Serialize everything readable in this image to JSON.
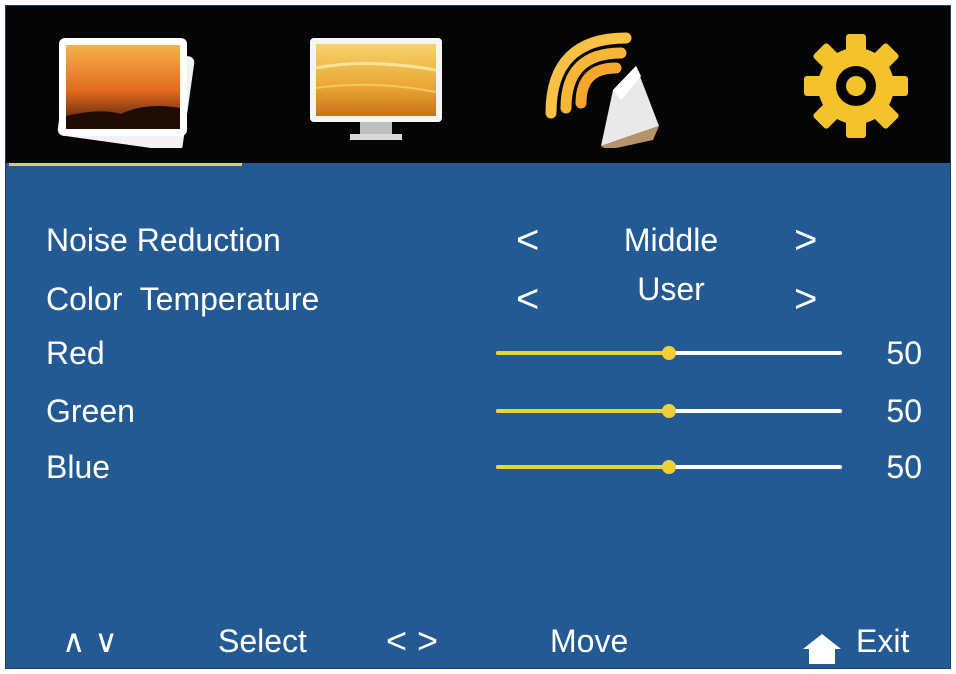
{
  "tabs": [
    {
      "name": "picture-tab",
      "icon": "photo-stack-icon"
    },
    {
      "name": "screen-tab",
      "icon": "monitor-icon"
    },
    {
      "name": "sound-tab",
      "icon": "speaker-waves-icon"
    },
    {
      "name": "setup-tab",
      "icon": "gear-icon"
    }
  ],
  "settings": {
    "noise_reduction": {
      "label": "Noise Reduction",
      "value": "Middle",
      "prev": "<",
      "next": ">"
    },
    "color_temperature": {
      "label": "Color  Temperature",
      "value": "User",
      "prev": "<",
      "next": ">"
    },
    "red": {
      "label": "Red",
      "value": 50,
      "display": "50"
    },
    "green": {
      "label": "Green",
      "value": 50,
      "display": "50"
    },
    "blue": {
      "label": "Blue",
      "value": 50,
      "display": "50"
    }
  },
  "slider_range": {
    "min": 0,
    "max": 100
  },
  "footer": {
    "updown_symbol": "∧ ∨",
    "select_label": "Select",
    "leftright_symbol": "< >",
    "move_label": "Move",
    "exit_label": "Exit",
    "exit_icon": "home-icon"
  },
  "colors": {
    "background": "#245a94",
    "topbar": "#050505",
    "accent": "#f0cf3a",
    "text": "#ffffff"
  }
}
